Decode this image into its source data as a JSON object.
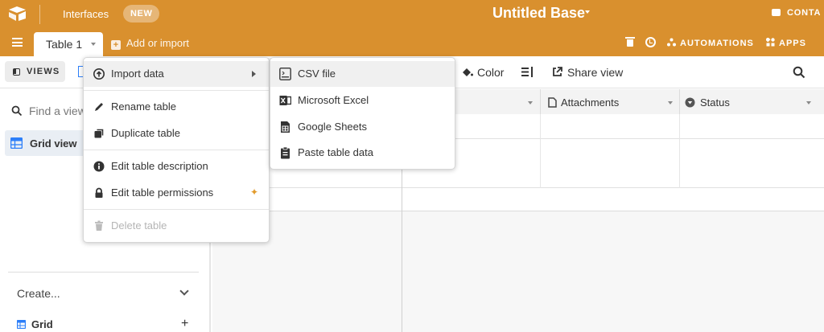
{
  "header": {
    "interfaces": "Interfaces",
    "new_badge": "NEW",
    "base_title": "Untitled Base",
    "contact": "CONTA"
  },
  "tabs": {
    "active": "Table 1",
    "add_or_import": "Add or import",
    "automations": "AUTOMATIONS",
    "apps": "APPS"
  },
  "viewbar": {
    "views": "VIEWS",
    "color": "Color",
    "share_view": "Share view"
  },
  "sidebar": {
    "find_placeholder": "Find a view",
    "active_view": "Grid view",
    "create": "Create...",
    "create_grid": "Grid",
    "plus": "+"
  },
  "grid": {
    "columns": [
      "",
      "Attachments",
      "Status"
    ],
    "rows": 3
  },
  "menu": {
    "items": [
      {
        "label": "Import data",
        "icon": "import-icon",
        "highlighted": true,
        "submenu": true
      },
      {
        "label": "Rename table",
        "icon": "pencil-icon"
      },
      {
        "label": "Duplicate table",
        "icon": "duplicate-icon"
      },
      {
        "label": "Edit table description",
        "icon": "info-icon"
      },
      {
        "label": "Edit table permissions",
        "icon": "lock-icon"
      },
      {
        "label": "Delete table",
        "icon": "trash-icon",
        "disabled": true
      }
    ]
  },
  "submenu": {
    "items": [
      {
        "label": "CSV file",
        "icon": "csv-icon",
        "highlighted": true
      },
      {
        "label": "Microsoft Excel",
        "icon": "excel-icon"
      },
      {
        "label": "Google Sheets",
        "icon": "sheets-icon"
      },
      {
        "label": "Paste table data",
        "icon": "clipboard-icon"
      }
    ]
  },
  "colors": {
    "brand_orange": "#d9902e",
    "grid_blue": "#2d7ff9",
    "highlight": "#f0f0f0"
  }
}
